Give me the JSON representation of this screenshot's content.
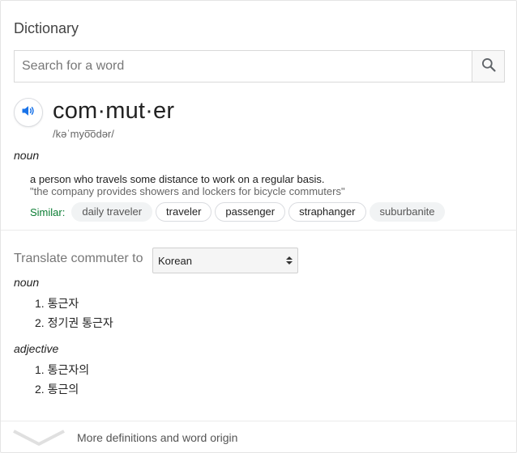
{
  "title": "Dictionary",
  "search": {
    "placeholder": "Search for a word",
    "value": ""
  },
  "entry": {
    "word": "com·mut·er",
    "phonetic": "/kəˈmyo͞odər/",
    "pos": "noun",
    "definition": "a person who travels some distance to work on a regular basis.",
    "example": "\"the company provides showers and lockers for bicycle commuters\"",
    "similar_label": "Similar:",
    "similar": [
      "daily traveler",
      "traveler",
      "passenger",
      "straphanger",
      "suburbanite"
    ]
  },
  "translate": {
    "label": "Translate commuter to",
    "language": "Korean",
    "groups": [
      {
        "pos": "noun",
        "items": [
          "1. 통근자",
          "2. 정기권 통근자"
        ]
      },
      {
        "pos": "adjective",
        "items": [
          "1. 통근자의",
          "2. 통근의"
        ]
      }
    ]
  },
  "footer": {
    "more_label": "More definitions and word origin"
  },
  "colors": {
    "accent_blue": "#1a73e8",
    "similar_green": "#0b7d33"
  },
  "icons": {
    "search": "search-icon",
    "audio": "speaker-icon",
    "expand": "chevron-down-icon"
  }
}
